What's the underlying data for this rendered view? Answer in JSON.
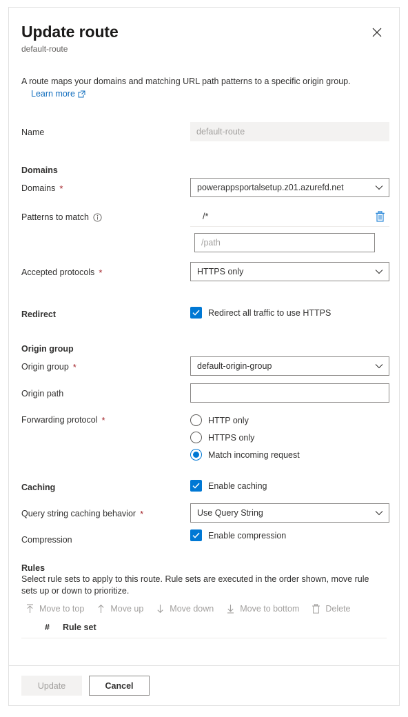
{
  "header": {
    "title": "Update route",
    "subtitle": "default-route",
    "close_icon": "close-icon",
    "description": "A route maps your domains and matching URL path patterns to a specific origin group.",
    "learn_more": "Learn more",
    "learn_more_icon": "external-link-icon"
  },
  "name_field": {
    "label": "Name",
    "value": "default-route",
    "disabled": true
  },
  "domains_section": {
    "heading": "Domains",
    "domains": {
      "label": "Domains",
      "required": "*",
      "selected": "powerappsportalsetup.z01.azurefd.net",
      "chevron_icon": "chevron-down-icon"
    },
    "patterns": {
      "label": "Patterns to match",
      "info_icon": "info-icon",
      "items": [
        {
          "value": "/*",
          "delete_icon": "trash-icon"
        }
      ],
      "new_placeholder": "/path",
      "new_value": ""
    },
    "accepted_protocols": {
      "label": "Accepted protocols",
      "required": "*",
      "selected": "HTTPS only",
      "chevron_icon": "chevron-down-icon"
    }
  },
  "redirect_section": {
    "label": "Redirect",
    "checkbox_label": "Redirect all traffic to use HTTPS",
    "checked": true,
    "check_icon": "check-icon"
  },
  "origin_section": {
    "heading": "Origin group",
    "origin_group": {
      "label": "Origin group",
      "required": "*",
      "selected": "default-origin-group",
      "chevron_icon": "chevron-down-icon"
    },
    "origin_path": {
      "label": "Origin path",
      "value": "",
      "placeholder": ""
    },
    "forwarding_protocol": {
      "label": "Forwarding protocol",
      "required": "*",
      "options": [
        "HTTP only",
        "HTTPS only",
        "Match incoming request"
      ],
      "selected": "Match incoming request"
    }
  },
  "caching_section": {
    "label": "Caching",
    "enable_caching_label": "Enable caching",
    "enable_caching_checked": true,
    "query_string": {
      "label": "Query string caching behavior",
      "required": "*",
      "selected": "Use Query String",
      "chevron_icon": "chevron-down-icon"
    },
    "compression": {
      "label": "Compression",
      "checkbox_label": "Enable compression",
      "checked": true
    }
  },
  "rules_section": {
    "title": "Rules",
    "description": "Select rule sets to apply to this route. Rule sets are executed in the order shown, move rule sets up or down to prioritize.",
    "toolbar": [
      {
        "label": "Move to top",
        "icon": "move-to-top-icon",
        "disabled": true
      },
      {
        "label": "Move up",
        "icon": "arrow-up-icon",
        "disabled": true
      },
      {
        "label": "Move down",
        "icon": "arrow-down-icon",
        "disabled": true
      },
      {
        "label": "Move to bottom",
        "icon": "move-to-bottom-icon",
        "disabled": true
      },
      {
        "label": "Delete",
        "icon": "trash-icon",
        "disabled": true
      }
    ],
    "table": {
      "columns": [
        "#",
        "Rule set"
      ],
      "rows": []
    }
  },
  "footer": {
    "update_label": "Update",
    "update_disabled": true,
    "cancel_label": "Cancel"
  },
  "colors": {
    "accent": "#0078d4",
    "link": "#0f6cbd",
    "required": "#a4262c",
    "trash": "#2b88d8",
    "disabled_text": "#a19f9d"
  }
}
